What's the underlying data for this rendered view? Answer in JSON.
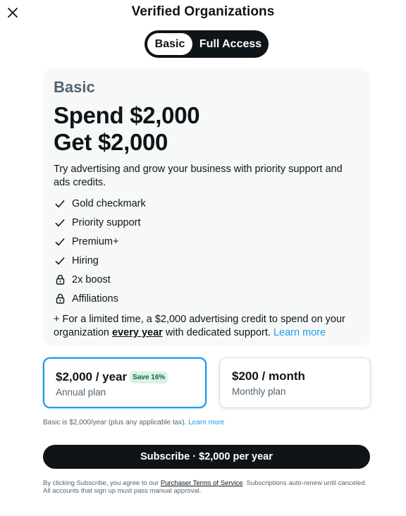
{
  "header": {
    "title": "Verified Organizations",
    "close_icon": "close-icon"
  },
  "toggle": {
    "options": [
      "Basic",
      "Full Access"
    ],
    "selected": "Basic"
  },
  "plan_card": {
    "name": "Basic",
    "headline_line1": "Spend $2,000",
    "headline_line2": "Get $2,000",
    "description": "Try advertising and grow your business with priority support and ads credits.",
    "features": [
      {
        "label": "Gold checkmark",
        "icon": "check-icon"
      },
      {
        "label": "Priority support",
        "icon": "check-icon"
      },
      {
        "label": "Premium+",
        "icon": "check-icon"
      },
      {
        "label": "Hiring",
        "icon": "check-icon"
      },
      {
        "label": "2x boost",
        "icon": "lock-icon"
      },
      {
        "label": "Affiliations",
        "icon": "lock-icon"
      }
    ],
    "promo_prefix": "+ For a limited time, a $2,000 advertising credit to spend on your organization ",
    "promo_emphasis": "every year",
    "promo_suffix": " with dedicated support. ",
    "promo_link": "Learn more"
  },
  "pricing": {
    "annual": {
      "price": "$2,000 / year",
      "badge": "Save 16%",
      "label": "Annual plan",
      "selected": true
    },
    "monthly": {
      "price": "$200 / month",
      "label": "Monthly plan",
      "selected": false
    }
  },
  "tax_note": {
    "text": "Basic is $2,000/year (plus any applicable tax). ",
    "link": "Learn more"
  },
  "subscribe_button": "Subscribe · $2,000 per year",
  "terms": {
    "prefix": "By clicking Subscribe, you agree to our ",
    "link": "Purchaser Terms of Service",
    "suffix": ". Subscriptions auto-renew until canceled. All accounts that sign up must pass manual approval."
  },
  "colors": {
    "accent": "#1d9bf0",
    "dark": "#0f1419",
    "muted": "#536471",
    "card_bg": "#f7f9f9",
    "badge_bg": "#def1e6",
    "badge_text": "#00703a"
  }
}
